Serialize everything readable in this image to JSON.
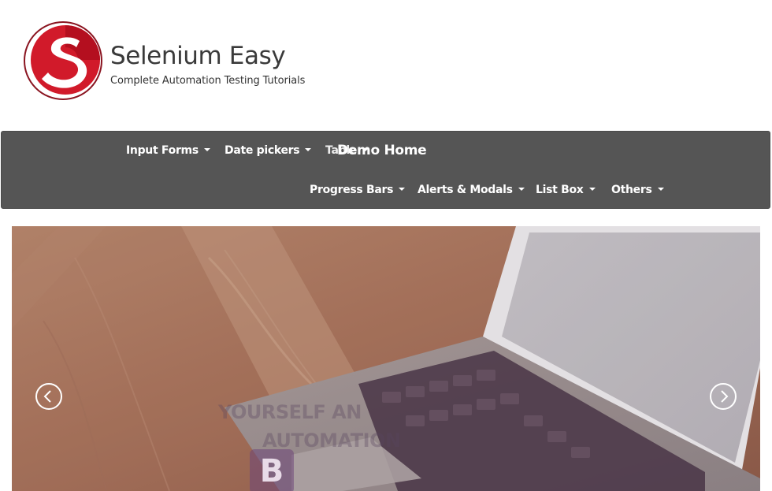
{
  "brand": {
    "title": "Selenium Easy",
    "subtitle": "Complete Automation Testing Tutorials",
    "logo_letter": "S",
    "logo_color": "#c8102e"
  },
  "navbar": {
    "background": "#555555",
    "home_label": "Demo Home",
    "overlap_label": "Table",
    "items_row1": [
      {
        "label": "Input Forms"
      },
      {
        "label": "Date pickers"
      }
    ],
    "items_row2": [
      {
        "label": "Progress Bars"
      },
      {
        "label": "Alerts & Modals"
      },
      {
        "label": "List Box"
      },
      {
        "label": "Others"
      }
    ]
  },
  "carousel": {
    "prev_icon": "chevron-left-icon",
    "next_icon": "chevron-right-icon",
    "slide_overlay_line1": "YOURSELF AN",
    "slide_overlay_line2": "AUTOMATION",
    "badge_letter": "B"
  }
}
